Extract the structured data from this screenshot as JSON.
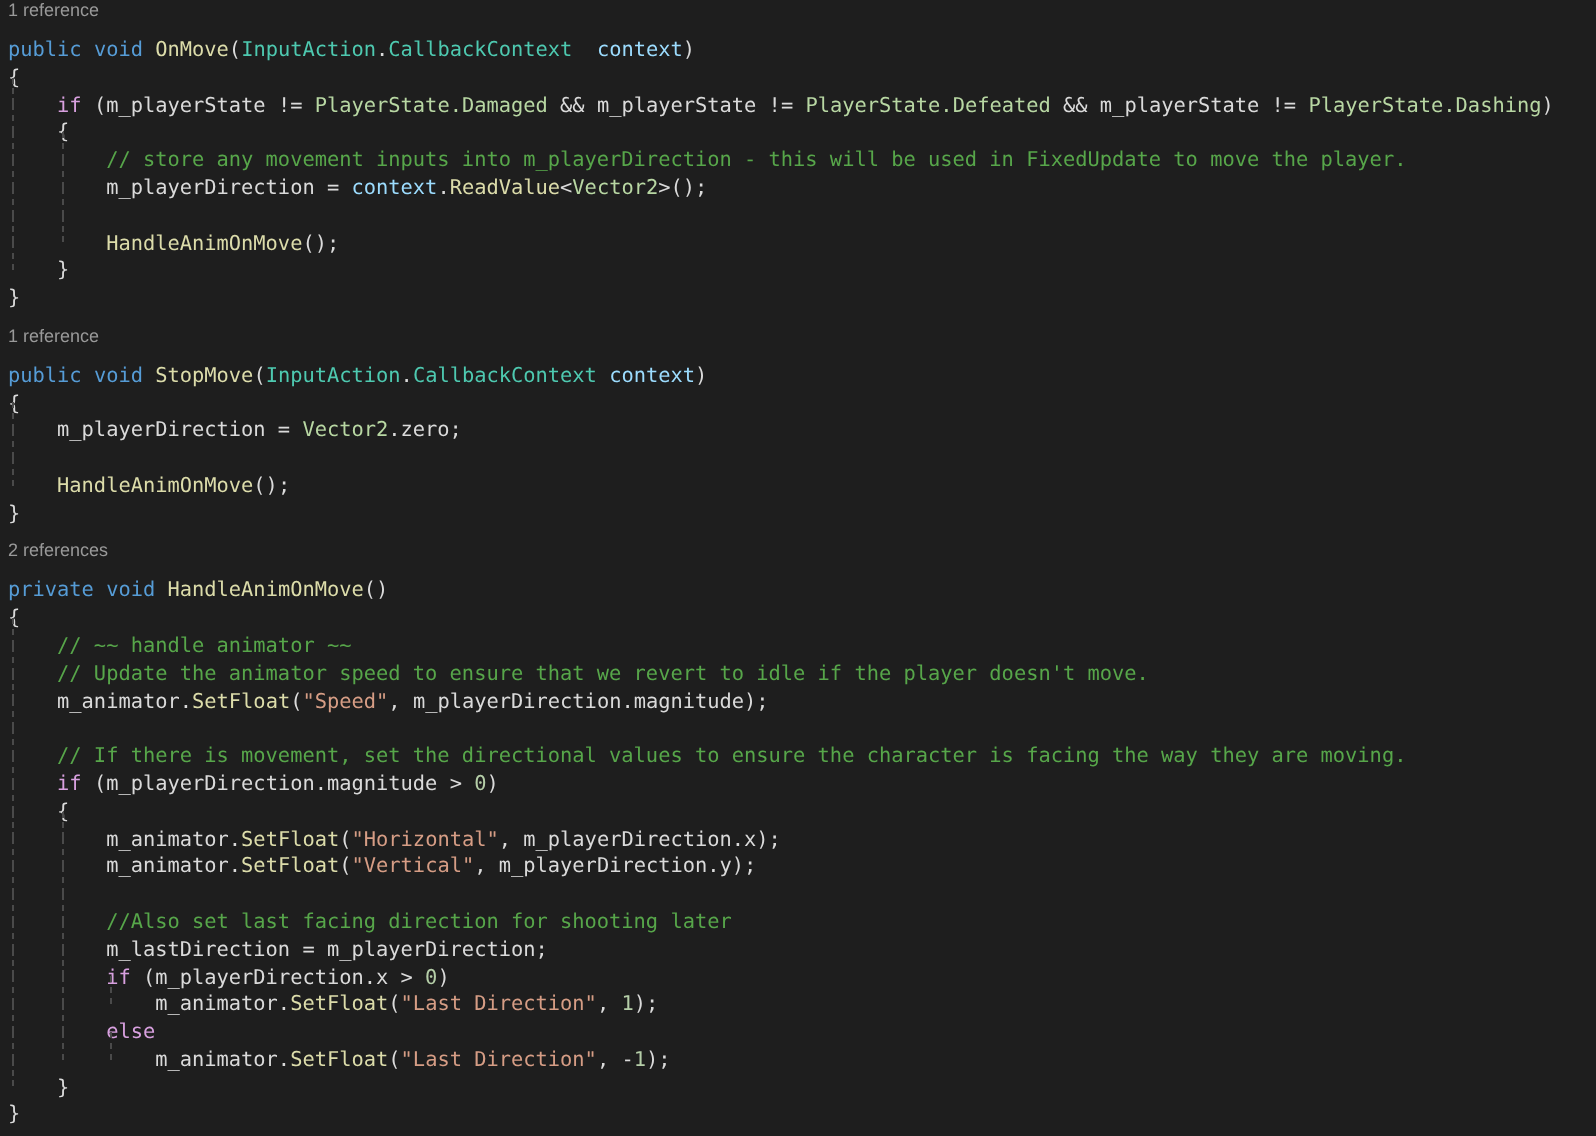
{
  "editor": {
    "lines": [
      {
        "kind": "codelens",
        "text": "1 reference"
      },
      {
        "kind": "code",
        "tokens": [
          {
            "kind": "k",
            "s": "public "
          },
          {
            "kind": "k",
            "s": "void "
          },
          {
            "kind": "m",
            "s": "OnMove"
          },
          {
            "kind": "f",
            "s": "("
          },
          {
            "kind": "t",
            "s": "InputAction"
          },
          {
            "kind": "f",
            "s": "."
          },
          {
            "kind": "t",
            "s": "CallbackContext  "
          },
          {
            "kind": "p",
            "s": "context"
          },
          {
            "kind": "f",
            "s": ")"
          }
        ]
      },
      {
        "kind": "code",
        "tokens": [
          {
            "kind": "f",
            "s": "{"
          }
        ]
      },
      {
        "kind": "code",
        "tokens": [
          {
            "kind": "c",
            "s": "    if"
          },
          {
            "kind": "f",
            "s": " (m_playerState != "
          },
          {
            "kind": "e",
            "s": "PlayerState.Damaged"
          },
          {
            "kind": "f",
            "s": " && m_playerState != "
          },
          {
            "kind": "e",
            "s": "PlayerState.Defeated"
          },
          {
            "kind": "f",
            "s": " && m_playerState != "
          },
          {
            "kind": "e",
            "s": "PlayerState.Dashing"
          },
          {
            "kind": "f",
            "s": ")"
          }
        ]
      },
      {
        "kind": "code",
        "tokens": [
          {
            "kind": "f",
            "s": "    {"
          }
        ]
      },
      {
        "kind": "code",
        "tokens": [
          {
            "kind": "g",
            "s": "        // store any movement inputs into m_playerDirection - this will be used in FixedUpdate to move the player."
          }
        ]
      },
      {
        "kind": "code",
        "tokens": [
          {
            "kind": "f",
            "s": "        m_playerDirection = "
          },
          {
            "kind": "p",
            "s": "context"
          },
          {
            "kind": "f",
            "s": "."
          },
          {
            "kind": "m",
            "s": "ReadValue"
          },
          {
            "kind": "f",
            "s": "<"
          },
          {
            "kind": "e",
            "s": "Vector2"
          },
          {
            "kind": "f",
            "s": ">();"
          }
        ]
      },
      {
        "kind": "blank"
      },
      {
        "kind": "code",
        "tokens": [
          {
            "kind": "m",
            "s": "        HandleAnimOnMove"
          },
          {
            "kind": "f",
            "s": "();"
          }
        ]
      },
      {
        "kind": "code",
        "tokens": [
          {
            "kind": "f",
            "s": "    }"
          }
        ]
      },
      {
        "kind": "code",
        "tokens": [
          {
            "kind": "f",
            "s": "}"
          }
        ]
      },
      {
        "kind": "blank"
      },
      {
        "kind": "codelens",
        "text": "1 reference"
      },
      {
        "kind": "code",
        "tokens": [
          {
            "kind": "k",
            "s": "public "
          },
          {
            "kind": "k",
            "s": "void "
          },
          {
            "kind": "m",
            "s": "StopMove"
          },
          {
            "kind": "f",
            "s": "("
          },
          {
            "kind": "t",
            "s": "InputAction"
          },
          {
            "kind": "f",
            "s": "."
          },
          {
            "kind": "t",
            "s": "CallbackContext "
          },
          {
            "kind": "p",
            "s": "context"
          },
          {
            "kind": "f",
            "s": ")"
          }
        ]
      },
      {
        "kind": "code",
        "tokens": [
          {
            "kind": "f",
            "s": "{"
          }
        ]
      },
      {
        "kind": "code",
        "tokens": [
          {
            "kind": "f",
            "s": "    m_playerDirection = "
          },
          {
            "kind": "e",
            "s": "Vector2"
          },
          {
            "kind": "f",
            "s": ".zero;"
          }
        ]
      },
      {
        "kind": "blank"
      },
      {
        "kind": "code",
        "tokens": [
          {
            "kind": "m",
            "s": "    HandleAnimOnMove"
          },
          {
            "kind": "f",
            "s": "();"
          }
        ]
      },
      {
        "kind": "code",
        "tokens": [
          {
            "kind": "f",
            "s": "}"
          }
        ]
      },
      {
        "kind": "blank"
      },
      {
        "kind": "codelens",
        "text": "2 references"
      },
      {
        "kind": "code",
        "tokens": [
          {
            "kind": "k",
            "s": "private "
          },
          {
            "kind": "k",
            "s": "void "
          },
          {
            "kind": "m",
            "s": "HandleAnimOnMove"
          },
          {
            "kind": "f",
            "s": "()"
          }
        ]
      },
      {
        "kind": "code",
        "tokens": [
          {
            "kind": "f",
            "s": "{"
          }
        ]
      },
      {
        "kind": "code",
        "tokens": [
          {
            "kind": "g",
            "s": "    // ~~ handle animator ~~"
          }
        ]
      },
      {
        "kind": "code",
        "tokens": [
          {
            "kind": "g",
            "s": "    // Update the animator speed to ensure that we revert to idle if the player doesn't move."
          }
        ]
      },
      {
        "kind": "code",
        "tokens": [
          {
            "kind": "f",
            "s": "    m_animator."
          },
          {
            "kind": "m",
            "s": "SetFloat"
          },
          {
            "kind": "f",
            "s": "("
          },
          {
            "kind": "s",
            "s": "\"Speed\""
          },
          {
            "kind": "f",
            "s": ", m_playerDirection.magnitude);"
          }
        ]
      },
      {
        "kind": "blank"
      },
      {
        "kind": "code",
        "tokens": [
          {
            "kind": "g",
            "s": "    // If there is movement, set the directional values to ensure the character is facing the way they are moving."
          }
        ]
      },
      {
        "kind": "code",
        "tokens": [
          {
            "kind": "c",
            "s": "    if"
          },
          {
            "kind": "f",
            "s": " (m_playerDirection.magnitude > "
          },
          {
            "kind": "n",
            "s": "0"
          },
          {
            "kind": "f",
            "s": ")"
          }
        ]
      },
      {
        "kind": "code",
        "tokens": [
          {
            "kind": "f",
            "s": "    {"
          }
        ]
      },
      {
        "kind": "code",
        "tokens": [
          {
            "kind": "f",
            "s": "        m_animator."
          },
          {
            "kind": "m",
            "s": "SetFloat"
          },
          {
            "kind": "f",
            "s": "("
          },
          {
            "kind": "s",
            "s": "\"Horizontal\""
          },
          {
            "kind": "f",
            "s": ", m_playerDirection.x);"
          }
        ]
      },
      {
        "kind": "code",
        "tokens": [
          {
            "kind": "f",
            "s": "        m_animator."
          },
          {
            "kind": "m",
            "s": "SetFloat"
          },
          {
            "kind": "f",
            "s": "("
          },
          {
            "kind": "s",
            "s": "\"Vertical\""
          },
          {
            "kind": "f",
            "s": ", m_playerDirection.y);"
          }
        ]
      },
      {
        "kind": "blank"
      },
      {
        "kind": "code",
        "tokens": [
          {
            "kind": "g",
            "s": "        //Also set last facing direction for shooting later"
          }
        ]
      },
      {
        "kind": "code",
        "tokens": [
          {
            "kind": "f",
            "s": "        m_lastDirection = m_playerDirection;"
          }
        ]
      },
      {
        "kind": "code",
        "tokens": [
          {
            "kind": "c",
            "s": "        if"
          },
          {
            "kind": "f",
            "s": " (m_playerDirection.x > "
          },
          {
            "kind": "n",
            "s": "0"
          },
          {
            "kind": "f",
            "s": ")"
          }
        ]
      },
      {
        "kind": "code",
        "tokens": [
          {
            "kind": "f",
            "s": "            m_animator."
          },
          {
            "kind": "m",
            "s": "SetFloat"
          },
          {
            "kind": "f",
            "s": "("
          },
          {
            "kind": "s",
            "s": "\"Last Direction\""
          },
          {
            "kind": "f",
            "s": ", "
          },
          {
            "kind": "n",
            "s": "1"
          },
          {
            "kind": "f",
            "s": ");"
          }
        ]
      },
      {
        "kind": "code",
        "tokens": [
          {
            "kind": "c",
            "s": "        else"
          }
        ]
      },
      {
        "kind": "code",
        "tokens": [
          {
            "kind": "f",
            "s": "            m_animator."
          },
          {
            "kind": "m",
            "s": "SetFloat"
          },
          {
            "kind": "f",
            "s": "("
          },
          {
            "kind": "s",
            "s": "\"Last Direction\""
          },
          {
            "kind": "f",
            "s": ", -"
          },
          {
            "kind": "n",
            "s": "1"
          },
          {
            "kind": "f",
            "s": ");"
          }
        ]
      },
      {
        "kind": "code",
        "tokens": [
          {
            "kind": "f",
            "s": "    }"
          }
        ]
      },
      {
        "kind": "code",
        "tokens": [
          {
            "kind": "f",
            "s": "}"
          }
        ]
      }
    ]
  }
}
